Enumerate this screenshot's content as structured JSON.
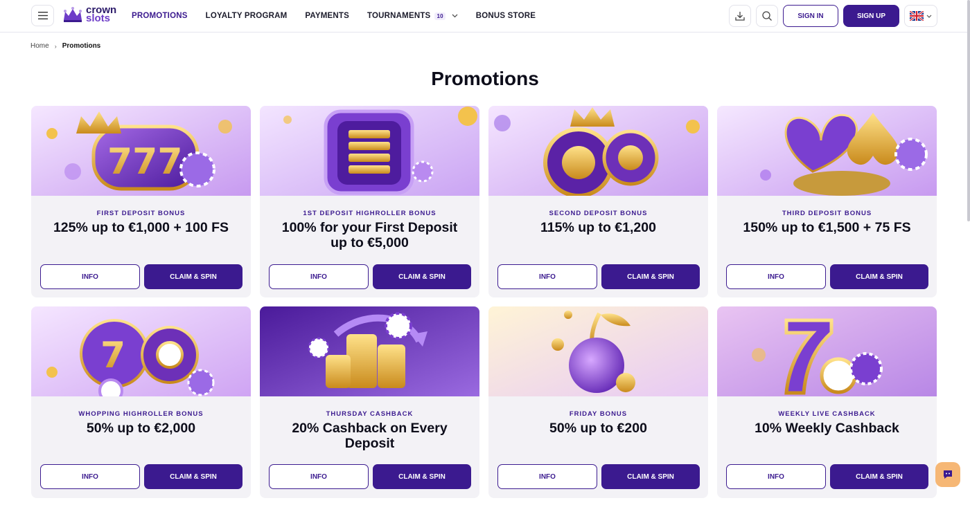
{
  "header": {
    "logo": {
      "line1": "crown",
      "line2": "slots"
    },
    "nav": [
      {
        "label": "PROMOTIONS"
      },
      {
        "label": "LOYALTY PROGRAM"
      },
      {
        "label": "PAYMENTS"
      },
      {
        "label": "TOURNAMENTS",
        "badge": "10"
      },
      {
        "label": "BONUS STORE"
      }
    ],
    "sign_in": "SIGN IN",
    "sign_up": "SIGN UP",
    "language": "en-gb-flag-icon"
  },
  "breadcrumb": {
    "home": "Home",
    "current": "Promotions"
  },
  "page": {
    "title": "Promotions"
  },
  "cards": [
    {
      "subtitle": "FIRST DEPOSIT BONUS",
      "title": "125% up to €1,000 + 100 FS",
      "info": "INFO",
      "claim": "CLAIM & SPIN"
    },
    {
      "subtitle": "1ST DEPOSIT HIGHROLLER BONUS",
      "title": "100% for your First Deposit up to €5,000",
      "info": "INFO",
      "claim": "CLAIM & SPIN"
    },
    {
      "subtitle": "SECOND DEPOSIT BONUS",
      "title": "115% up to €1,200",
      "info": "INFO",
      "claim": "CLAIM & SPIN"
    },
    {
      "subtitle": "THIRD DEPOSIT BONUS",
      "title": "150% up to €1,500 + 75 FS",
      "info": "INFO",
      "claim": "CLAIM & SPIN"
    },
    {
      "subtitle": "WHOPPING HIGHROLLER BONUS",
      "title": "50% up to €2,000",
      "info": "INFO",
      "claim": "CLAIM & SPIN"
    },
    {
      "subtitle": "THURSDAY CASHBACK",
      "title": "20% Cashback on Every Deposit",
      "info": "INFO",
      "claim": "CLAIM & SPIN"
    },
    {
      "subtitle": "FRIDAY BONUS",
      "title": "50% up to €200",
      "info": "INFO",
      "claim": "CLAIM & SPIN"
    },
    {
      "subtitle": "WEEKLY LIVE CASHBACK",
      "title": "10% Weekly Cashback",
      "info": "INFO",
      "claim": "CLAIM & SPIN"
    }
  ],
  "colors": {
    "brand": "#3b1a8f",
    "card_bg": "#f3f2f6",
    "chat": "#f6b775"
  }
}
